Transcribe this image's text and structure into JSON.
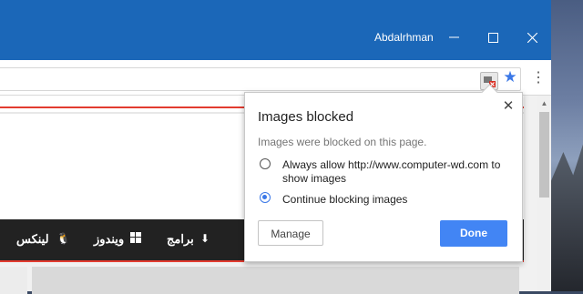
{
  "titlebar": {
    "user": "Abdalrhman"
  },
  "toolbar": {
    "blocked_icon": "images-blocked-icon",
    "star_icon": "star-icon",
    "menu_icon": "more-vert-icon"
  },
  "navbar": {
    "items": [
      {
        "label": "لينكس",
        "icon": "linux-icon"
      },
      {
        "label": "ويندوز",
        "icon": "windows-icon"
      },
      {
        "label": "برامج",
        "icon": "download-icon"
      }
    ]
  },
  "popup": {
    "title": "Images blocked",
    "message": "Images were blocked on this page.",
    "option_allow": "Always allow http://www.computer-wd.com to show images",
    "option_block": "Continue blocking images",
    "selected": "option_block",
    "manage_label": "Manage",
    "done_label": "Done",
    "close_glyph": "✕"
  },
  "colors": {
    "titlebar": "#1b67b8",
    "accent": "#4285f4",
    "nav": "#222222",
    "red": "#e23b2f"
  }
}
